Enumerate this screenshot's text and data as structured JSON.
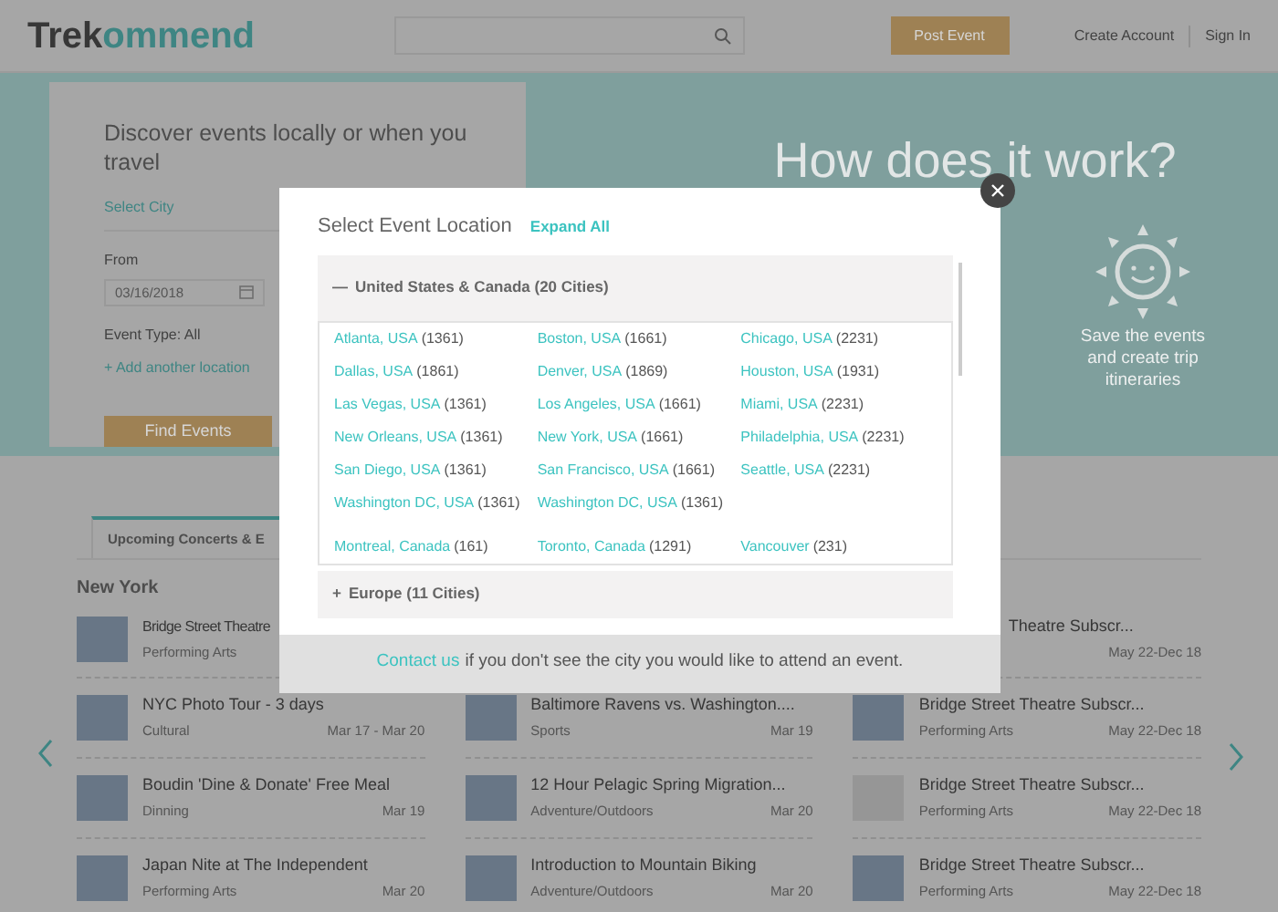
{
  "header": {
    "logo_dark": "Trek",
    "logo_accent": "ommend",
    "post_button": "Post Event",
    "links": [
      "Create Account",
      "Sign In"
    ]
  },
  "hero": {
    "card": {
      "title": "Discover events locally or when you travel",
      "city_placeholder": "Select City",
      "from_label": "From",
      "date": "03/16/2018",
      "event_type": "Event Type: All",
      "add_location": "+ Add another location",
      "find_button": "Find Events"
    },
    "heading": "How does it work?",
    "caption": "Save the events and create trip itineraries"
  },
  "tab": {
    "label": "Upcoming Concerts & E",
    "selected": true
  },
  "city_heading": "New York",
  "events": {
    "partial_row": {
      "left": {
        "title": "Bridge Street Theatre",
        "category": "Performing Arts"
      },
      "right": {
        "title": "Theatre Subscr...",
        "date": "May 22-Dec 18"
      }
    },
    "rows": [
      [
        {
          "title": "NYC Photo Tour - 3 days",
          "category": "Cultural",
          "date": "Mar 17 - Mar 20"
        },
        {
          "title": "Baltimore Ravens vs. Washington....",
          "category": "Sports",
          "date": "Mar 19"
        },
        {
          "title": "Bridge Street Theatre Subscr...",
          "category": "Performing Arts",
          "date": "May 22-Dec 18"
        }
      ],
      [
        {
          "title": "Boudin 'Dine & Donate' Free Meal",
          "category": "Dinning",
          "date": "Mar 19"
        },
        {
          "title": "12 Hour Pelagic Spring Migration...",
          "category": "Adventure/Outdoors",
          "date": "Mar 20"
        },
        {
          "title": "Bridge Street Theatre Subscr...",
          "category": "Performing Arts",
          "date": "May 22-Dec 18"
        }
      ],
      [
        {
          "title": "Japan Nite at The Independent",
          "category": "Performing Arts",
          "date": "Mar 20"
        },
        {
          "title": "Introduction to Mountain Biking",
          "category": "Adventure/Outdoors",
          "date": "Mar 20"
        },
        {
          "title": "Bridge Street Theatre Subscr...",
          "category": "Performing Arts",
          "date": "May 22-Dec 18"
        }
      ]
    ]
  },
  "modal": {
    "title": "Select Event Location",
    "expand_all": "Expand All",
    "regions": [
      {
        "toggle": "—",
        "label": "United States & Canada (20 Cities)",
        "expanded": true,
        "groups": [
          {
            "cities": [
              {
                "name": "Atlanta, USA",
                "count": "(1361)"
              },
              {
                "name": "Boston, USA",
                "count": "(1661)"
              },
              {
                "name": "Chicago, USA",
                "count": "(2231)"
              },
              {
                "name": "Dallas, USA",
                "count": "(1861)"
              },
              {
                "name": "Denver, USA",
                "count": "(1869)"
              },
              {
                "name": "Houston, USA",
                "count": "(1931)"
              },
              {
                "name": "Las Vegas, USA",
                "count": "(1361)"
              },
              {
                "name": "Los Angeles, USA",
                "count": "(1661)"
              },
              {
                "name": "Miami, USA",
                "count": "(2231)"
              },
              {
                "name": "New Orleans, USA",
                "count": "(1361)"
              },
              {
                "name": "New York, USA",
                "count": "(1661)"
              },
              {
                "name": "Philadelphia, USA",
                "count": "(2231)"
              },
              {
                "name": "San Diego, USA",
                "count": "(1361)"
              },
              {
                "name": "San Francisco, USA",
                "count": "(1661)"
              },
              {
                "name": "Seattle, USA",
                "count": "(2231)"
              },
              {
                "name": "Washington DC, USA",
                "count": "(1361)"
              },
              {
                "name": "Washington DC, USA",
                "count": "(1361)"
              }
            ]
          },
          {
            "cities": [
              {
                "name": "Montreal, Canada",
                "count": "(161)"
              },
              {
                "name": "Toronto, Canada",
                "count": "(1291)"
              },
              {
                "name": "Vancouver",
                "count": "(231)"
              }
            ]
          }
        ]
      },
      {
        "toggle": "+",
        "label": "Europe (11 Cities)",
        "expanded": false
      }
    ],
    "footer_link": "Contact us",
    "footer_text": "if you don't see the city you would like to attend an event."
  }
}
